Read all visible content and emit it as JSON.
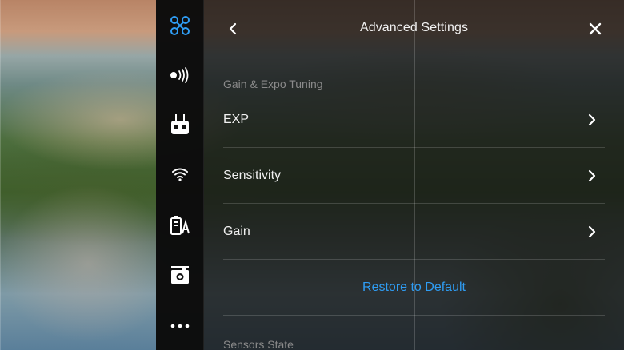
{
  "panel": {
    "title": "Advanced Settings",
    "section_gain_expo": "Gain & Expo Tuning",
    "rows": [
      {
        "label": "EXP"
      },
      {
        "label": "Sensitivity"
      },
      {
        "label": "Gain"
      }
    ],
    "restore_label": "Restore to Default",
    "section_sensors": "Sensors State"
  },
  "sidebar": {
    "items": [
      {
        "icon": "aircraft-icon",
        "active": true
      },
      {
        "icon": "signal-icon",
        "active": false
      },
      {
        "icon": "remote-controller-icon",
        "active": false
      },
      {
        "icon": "wifi-icon",
        "active": false
      },
      {
        "icon": "battery-icon",
        "active": false
      },
      {
        "icon": "camera-icon",
        "active": false
      },
      {
        "icon": "more-icon",
        "active": false
      }
    ]
  },
  "colors": {
    "accent": "#2f9df4",
    "text_primary": "#f0f0f0",
    "text_secondary": "#8a8a8a"
  }
}
